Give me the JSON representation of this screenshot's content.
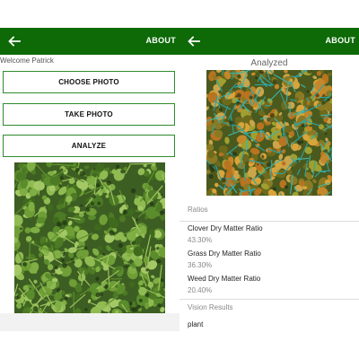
{
  "left_screen": {
    "appbar": {
      "back_icon": "arrow-left-icon",
      "about_label": "ABOUT"
    },
    "welcome_text": "Welcome Patrick",
    "buttons": {
      "choose_photo": "CHOOSE PHOTO",
      "take_photo": "TAKE PHOTO",
      "analyze": "ANALYZE"
    }
  },
  "right_screen": {
    "appbar": {
      "back_icon": "arrow-left-icon",
      "about_label": "ABOUT"
    },
    "title": "Analyzed",
    "ratios_header": "Ratios",
    "ratios": [
      {
        "name": "Clover Dry Matter Ratio",
        "value": "43.30%"
      },
      {
        "name": "Grass Dry Matter Ratio",
        "value": "36.30%"
      },
      {
        "name": "Weed Dry Matter Ratio",
        "value": "20.40%"
      }
    ],
    "vision_header": "Vision Results",
    "vision_results": [
      "plant"
    ]
  },
  "colors": {
    "appbar": "#0d6a07",
    "button_border": "#2e8b2e",
    "clover": "#4f8a2a",
    "grass_overlay": "#2aa0a0",
    "weed_overlay": "#d08a1e"
  }
}
